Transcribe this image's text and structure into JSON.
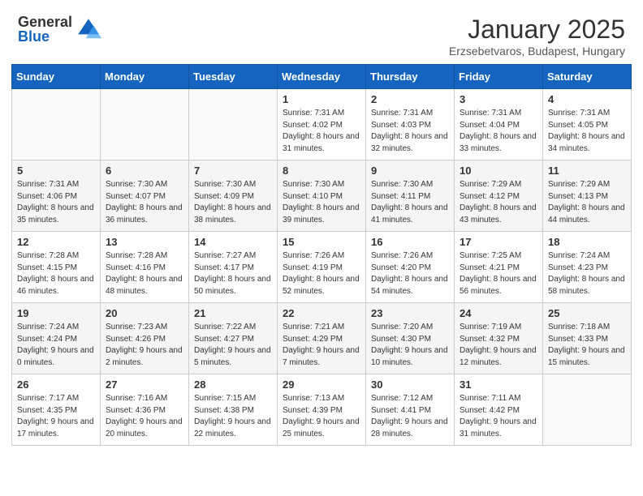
{
  "logo": {
    "general": "General",
    "blue": "Blue"
  },
  "title": "January 2025",
  "subtitle": "Erzsebetvaros, Budapest, Hungary",
  "headers": [
    "Sunday",
    "Monday",
    "Tuesday",
    "Wednesday",
    "Thursday",
    "Friday",
    "Saturday"
  ],
  "weeks": [
    [
      {
        "day": "",
        "info": ""
      },
      {
        "day": "",
        "info": ""
      },
      {
        "day": "",
        "info": ""
      },
      {
        "day": "1",
        "info": "Sunrise: 7:31 AM\nSunset: 4:02 PM\nDaylight: 8 hours and 31 minutes."
      },
      {
        "day": "2",
        "info": "Sunrise: 7:31 AM\nSunset: 4:03 PM\nDaylight: 8 hours and 32 minutes."
      },
      {
        "day": "3",
        "info": "Sunrise: 7:31 AM\nSunset: 4:04 PM\nDaylight: 8 hours and 33 minutes."
      },
      {
        "day": "4",
        "info": "Sunrise: 7:31 AM\nSunset: 4:05 PM\nDaylight: 8 hours and 34 minutes."
      }
    ],
    [
      {
        "day": "5",
        "info": "Sunrise: 7:31 AM\nSunset: 4:06 PM\nDaylight: 8 hours and 35 minutes."
      },
      {
        "day": "6",
        "info": "Sunrise: 7:30 AM\nSunset: 4:07 PM\nDaylight: 8 hours and 36 minutes."
      },
      {
        "day": "7",
        "info": "Sunrise: 7:30 AM\nSunset: 4:09 PM\nDaylight: 8 hours and 38 minutes."
      },
      {
        "day": "8",
        "info": "Sunrise: 7:30 AM\nSunset: 4:10 PM\nDaylight: 8 hours and 39 minutes."
      },
      {
        "day": "9",
        "info": "Sunrise: 7:30 AM\nSunset: 4:11 PM\nDaylight: 8 hours and 41 minutes."
      },
      {
        "day": "10",
        "info": "Sunrise: 7:29 AM\nSunset: 4:12 PM\nDaylight: 8 hours and 43 minutes."
      },
      {
        "day": "11",
        "info": "Sunrise: 7:29 AM\nSunset: 4:13 PM\nDaylight: 8 hours and 44 minutes."
      }
    ],
    [
      {
        "day": "12",
        "info": "Sunrise: 7:28 AM\nSunset: 4:15 PM\nDaylight: 8 hours and 46 minutes."
      },
      {
        "day": "13",
        "info": "Sunrise: 7:28 AM\nSunset: 4:16 PM\nDaylight: 8 hours and 48 minutes."
      },
      {
        "day": "14",
        "info": "Sunrise: 7:27 AM\nSunset: 4:17 PM\nDaylight: 8 hours and 50 minutes."
      },
      {
        "day": "15",
        "info": "Sunrise: 7:26 AM\nSunset: 4:19 PM\nDaylight: 8 hours and 52 minutes."
      },
      {
        "day": "16",
        "info": "Sunrise: 7:26 AM\nSunset: 4:20 PM\nDaylight: 8 hours and 54 minutes."
      },
      {
        "day": "17",
        "info": "Sunrise: 7:25 AM\nSunset: 4:21 PM\nDaylight: 8 hours and 56 minutes."
      },
      {
        "day": "18",
        "info": "Sunrise: 7:24 AM\nSunset: 4:23 PM\nDaylight: 8 hours and 58 minutes."
      }
    ],
    [
      {
        "day": "19",
        "info": "Sunrise: 7:24 AM\nSunset: 4:24 PM\nDaylight: 9 hours and 0 minutes."
      },
      {
        "day": "20",
        "info": "Sunrise: 7:23 AM\nSunset: 4:26 PM\nDaylight: 9 hours and 2 minutes."
      },
      {
        "day": "21",
        "info": "Sunrise: 7:22 AM\nSunset: 4:27 PM\nDaylight: 9 hours and 5 minutes."
      },
      {
        "day": "22",
        "info": "Sunrise: 7:21 AM\nSunset: 4:29 PM\nDaylight: 9 hours and 7 minutes."
      },
      {
        "day": "23",
        "info": "Sunrise: 7:20 AM\nSunset: 4:30 PM\nDaylight: 9 hours and 10 minutes."
      },
      {
        "day": "24",
        "info": "Sunrise: 7:19 AM\nSunset: 4:32 PM\nDaylight: 9 hours and 12 minutes."
      },
      {
        "day": "25",
        "info": "Sunrise: 7:18 AM\nSunset: 4:33 PM\nDaylight: 9 hours and 15 minutes."
      }
    ],
    [
      {
        "day": "26",
        "info": "Sunrise: 7:17 AM\nSunset: 4:35 PM\nDaylight: 9 hours and 17 minutes."
      },
      {
        "day": "27",
        "info": "Sunrise: 7:16 AM\nSunset: 4:36 PM\nDaylight: 9 hours and 20 minutes."
      },
      {
        "day": "28",
        "info": "Sunrise: 7:15 AM\nSunset: 4:38 PM\nDaylight: 9 hours and 22 minutes."
      },
      {
        "day": "29",
        "info": "Sunrise: 7:13 AM\nSunset: 4:39 PM\nDaylight: 9 hours and 25 minutes."
      },
      {
        "day": "30",
        "info": "Sunrise: 7:12 AM\nSunset: 4:41 PM\nDaylight: 9 hours and 28 minutes."
      },
      {
        "day": "31",
        "info": "Sunrise: 7:11 AM\nSunset: 4:42 PM\nDaylight: 9 hours and 31 minutes."
      },
      {
        "day": "",
        "info": ""
      }
    ]
  ]
}
